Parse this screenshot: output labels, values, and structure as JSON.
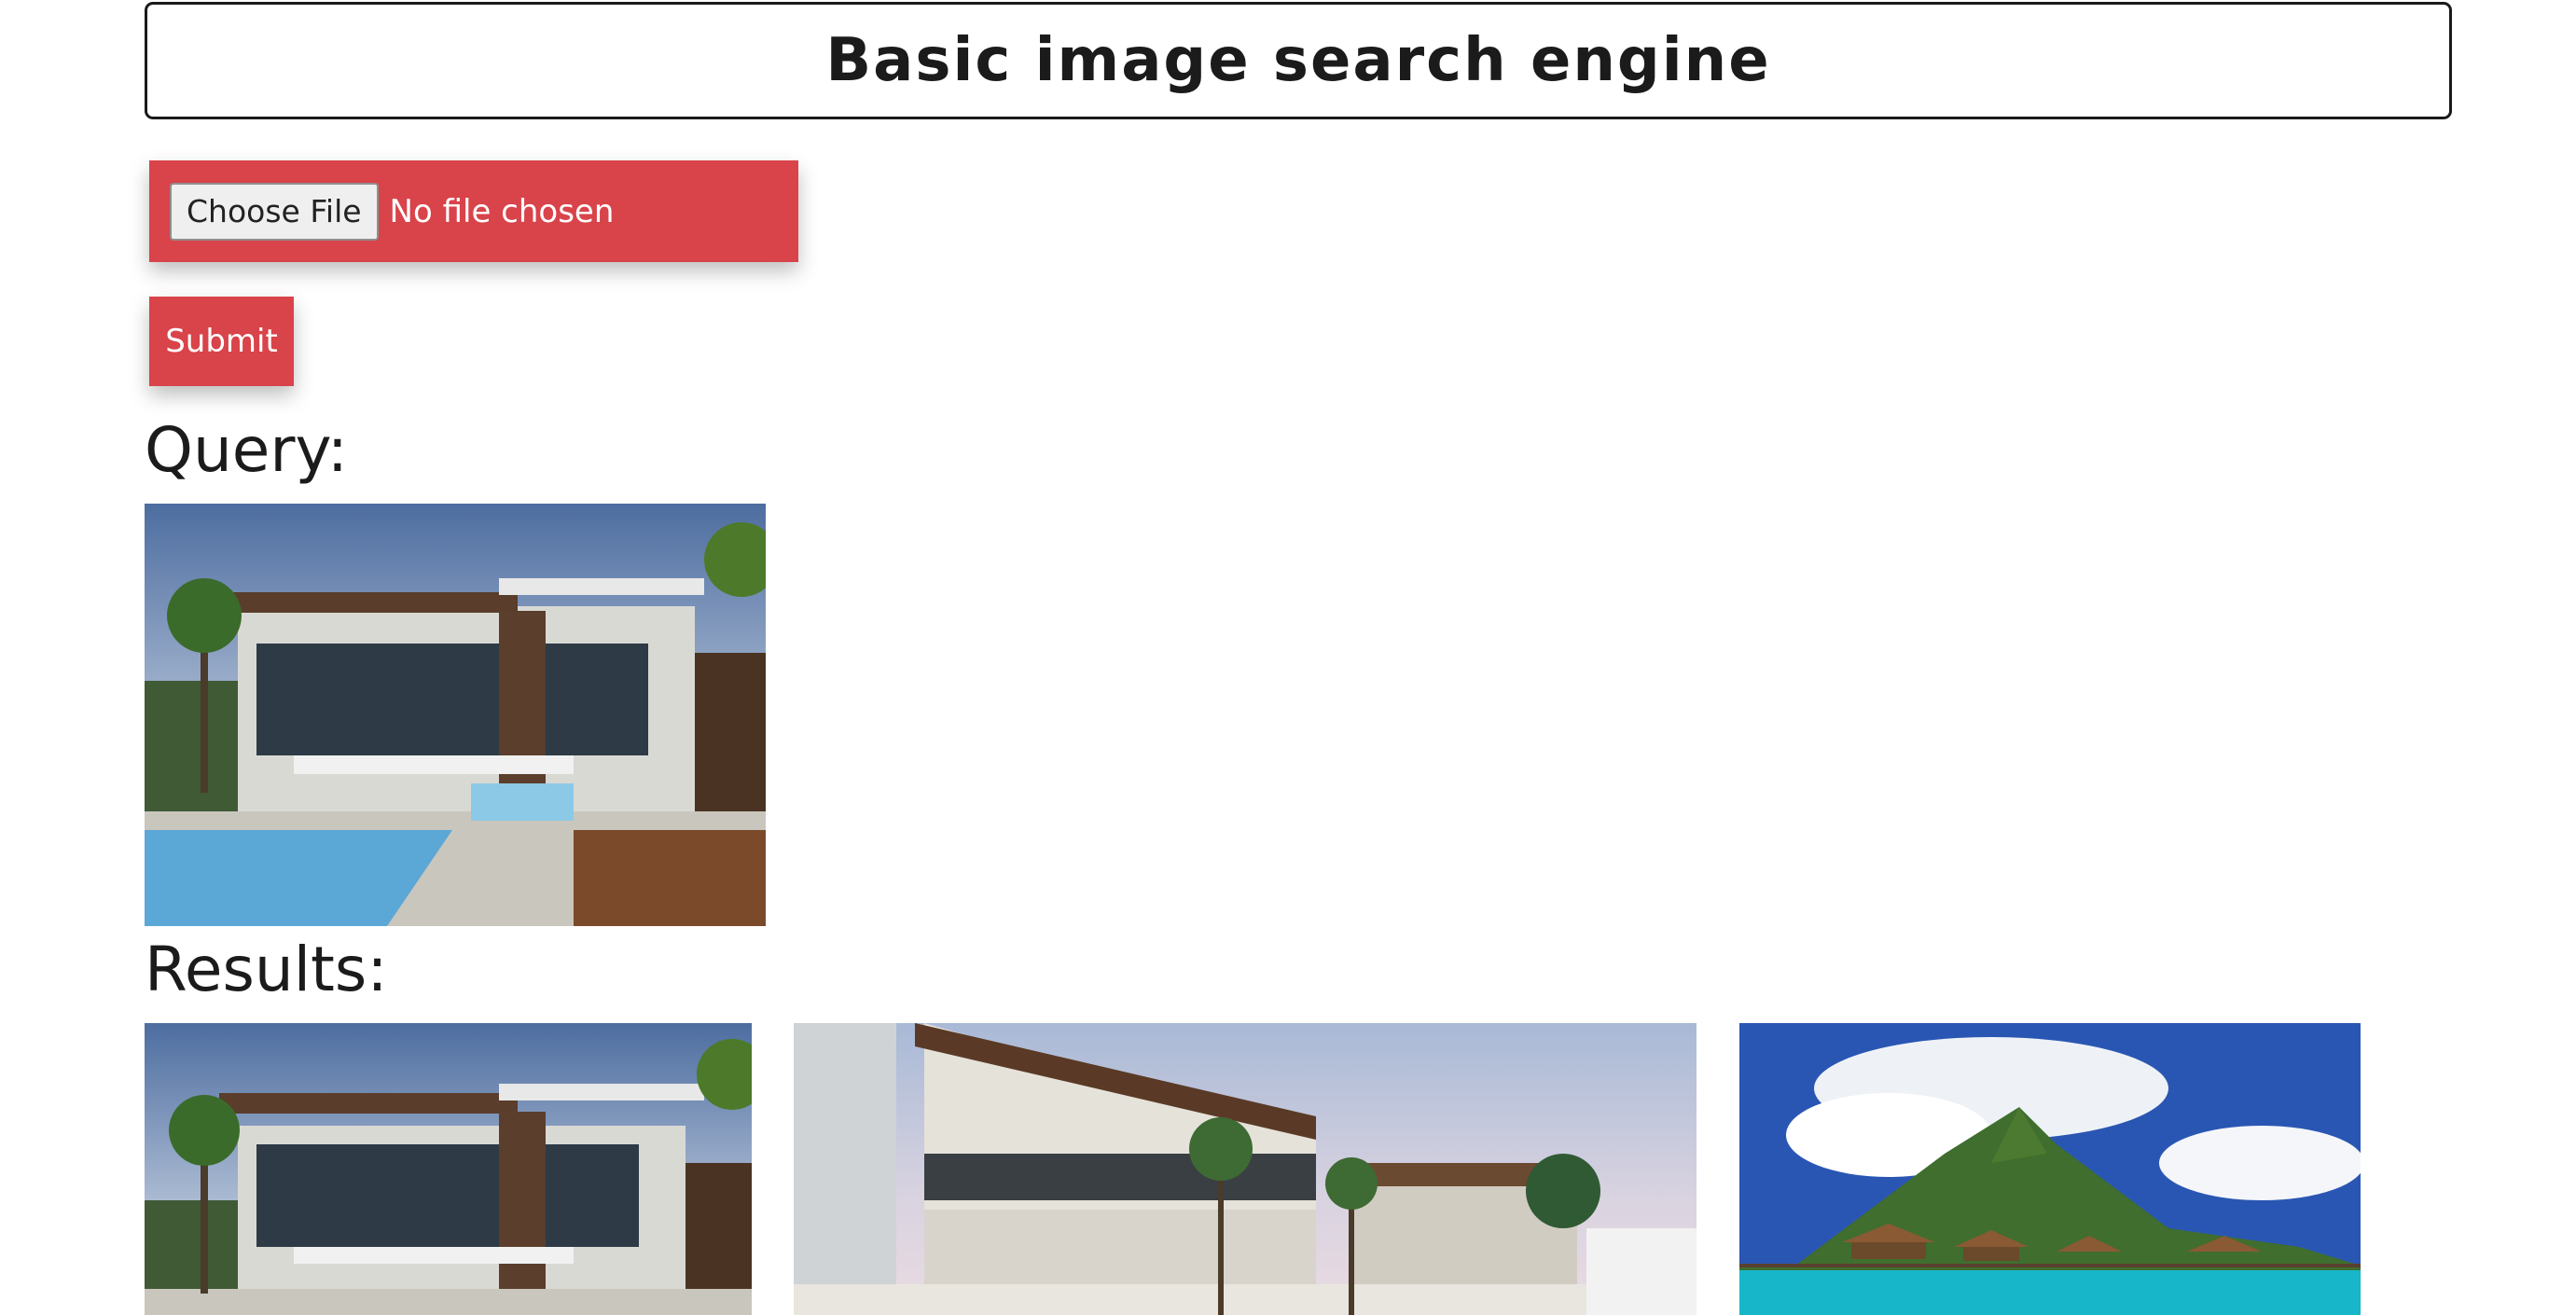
{
  "header": {
    "title": "Basic image search engine"
  },
  "upload": {
    "choose_label": "Choose File",
    "status_text": "No file chosen"
  },
  "submit": {
    "label": "Submit"
  },
  "query": {
    "heading": "Query:"
  },
  "results": {
    "heading": "Results:",
    "images": [
      "modern-villa-with-pool",
      "modern-luxury-house-sunset",
      "tropical-island-overwater-bungalows"
    ]
  },
  "colors": {
    "accent": "#d9434a",
    "text": "#1b1b1b"
  }
}
